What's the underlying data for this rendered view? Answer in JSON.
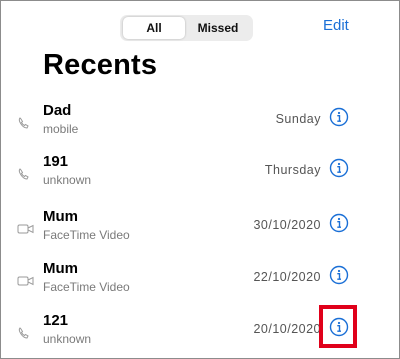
{
  "header": {
    "segments": [
      {
        "label": "All",
        "selected": true
      },
      {
        "label": "Missed",
        "selected": false
      }
    ],
    "edit_label": "Edit",
    "title": "Recents"
  },
  "calls": [
    {
      "name": "Dad",
      "subtitle": "mobile",
      "date": "Sunday",
      "icon": "phone-icon"
    },
    {
      "name": "191",
      "subtitle": "unknown",
      "date": "Thursday",
      "icon": "phone-icon"
    },
    {
      "name": "Mum",
      "subtitle": "FaceTime Video",
      "date": "30/10/2020",
      "icon": "video-camera-icon"
    },
    {
      "name": "Mum",
      "subtitle": "FaceTime Video",
      "date": "22/10/2020",
      "icon": "video-camera-icon"
    },
    {
      "name": "121",
      "subtitle": "unknown",
      "date": "20/10/2020",
      "icon": "phone-icon"
    }
  ],
  "colors": {
    "accent": "#1a6fd6",
    "highlight": "#e0001a",
    "secondary_text": "#7a7a7a"
  }
}
